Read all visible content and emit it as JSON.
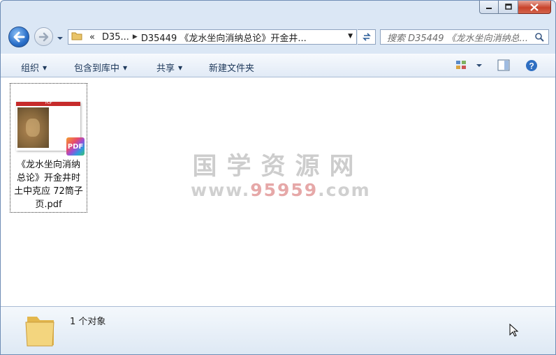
{
  "window": {
    "caption_buttons": [
      "minimize",
      "maximize",
      "close"
    ]
  },
  "address": {
    "chevron": "«",
    "segments": [
      "D35...",
      "D35449 《龙水坐向消纳总论》开金井..."
    ],
    "search_placeholder": "搜索 D35449 《龙水坐向消纳总..."
  },
  "toolbar": {
    "organize": "组织",
    "include_library": "包含到库中",
    "share": "共享",
    "new_folder": "新建文件夹"
  },
  "files": [
    {
      "name": "《龙水坐向消纳总论》开金井时土中克应 72筒子页.pdf",
      "name_lines": [
        "《龙水坐向消纳",
        "总论》开金井时",
        "土中克应 72筒子",
        "页.pdf"
      ],
      "type_badge": "PDF",
      "thumb_header": "PDF"
    }
  ],
  "watermark": {
    "line1": "国学资源网",
    "line2_prefix": "www.",
    "line2_highlight": "95959",
    "line2_suffix": ".com"
  },
  "details": {
    "count": "1 个对象"
  },
  "colors": {
    "frame": "#dbe7f5",
    "toolbar_text": "#1e395b",
    "close_red": "#c8432b",
    "pdf_red": "#c62b2b"
  },
  "icons": [
    "back-arrow-icon",
    "forward-arrow-icon",
    "folder-icon",
    "refresh-icon",
    "search-icon",
    "view-options-icon",
    "preview-pane-icon",
    "help-icon",
    "pdf-file-icon",
    "cursor-icon"
  ]
}
